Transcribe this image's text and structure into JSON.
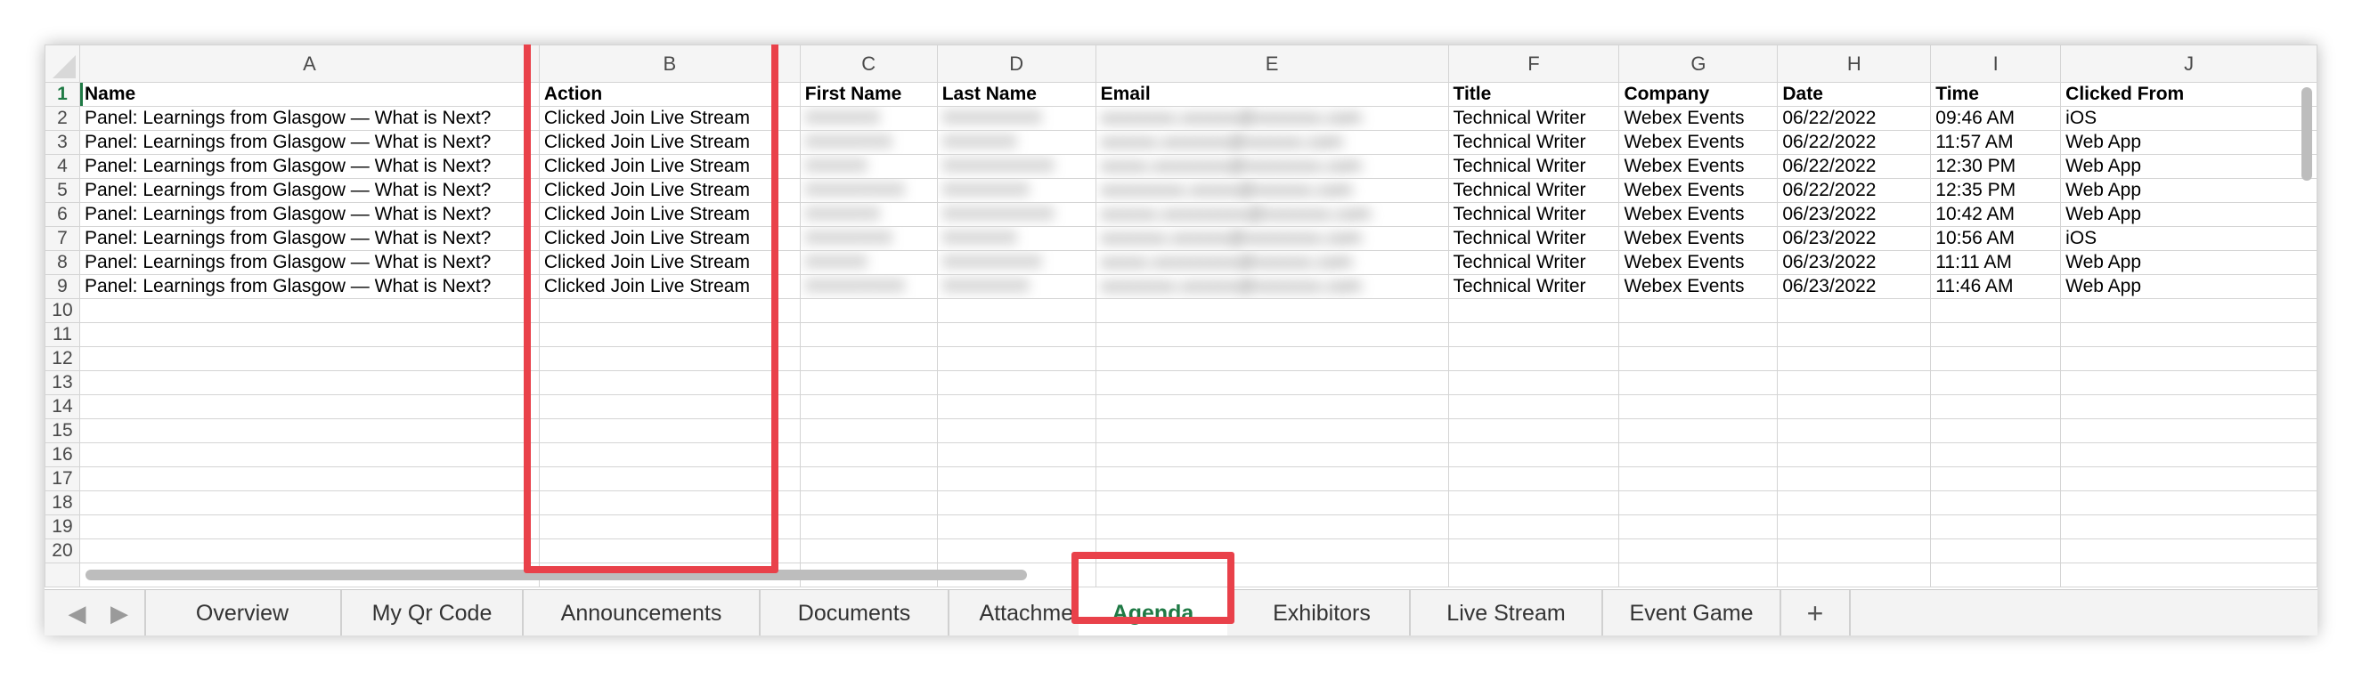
{
  "columns": [
    "A",
    "B",
    "C",
    "D",
    "E",
    "F",
    "G",
    "H",
    "I",
    "J"
  ],
  "header_row": [
    "Name",
    "Action",
    "First Name",
    "Last Name",
    "Email",
    "Title",
    "Company",
    "Date",
    "Time",
    "Clicked From"
  ],
  "rows": [
    [
      "Panel: Learnings from Glasgow — What is Next?",
      "Clicked Join Live Stream",
      "XXXXXX",
      "XXXXXXXX",
      "xxxxxxxx.xxxxxx@xxxxxxx.com",
      "Technical Writer",
      "Webex Events",
      "06/22/2022",
      "09:46 AM",
      "iOS"
    ],
    [
      "Panel: Learnings from Glasgow — What is Next?",
      "Clicked Join Live Stream",
      "XXXXXXX",
      "XXXXXX",
      "xxxxxx.xxxxxxx@xxxxxx.com",
      "Technical Writer",
      "Webex Events",
      "06/22/2022",
      "11:57 AM",
      "Web App"
    ],
    [
      "Panel: Learnings from Glasgow — What is Next?",
      "Clicked Join Live Stream",
      "XXXXX",
      "XXXXXXXXX",
      "xxxxx.xxxxxxxx@xxxxxxxx.com",
      "Technical Writer",
      "Webex Events",
      "06/22/2022",
      "12:30 PM",
      "Web App"
    ],
    [
      "Panel: Learnings from Glasgow — What is Next?",
      "Clicked Join Live Stream",
      "XXXXXXXX",
      "XXXXXXX",
      "xxxxxxxxx.xxxxx@xxxxxx.com",
      "Technical Writer",
      "Webex Events",
      "06/22/2022",
      "12:35 PM",
      "Web App"
    ],
    [
      "Panel: Learnings from Glasgow — What is Next?",
      "Clicked Join Live Stream",
      "XXXXXX",
      "XXXXXXXXX",
      "xxxxxx.xxxxxxxxx@xxxxxxx.com",
      "Technical Writer",
      "Webex Events",
      "06/23/2022",
      "10:42 AM",
      "Web App"
    ],
    [
      "Panel: Learnings from Glasgow — What is Next?",
      "Clicked Join Live Stream",
      "XXXXXXX",
      "XXXXXX",
      "xxxxxxx.xxxxxx@xxxxxxxx.com",
      "Technical Writer",
      "Webex Events",
      "06/23/2022",
      "10:56 AM",
      "iOS"
    ],
    [
      "Panel: Learnings from Glasgow — What is Next?",
      "Clicked Join Live Stream",
      "XXXXX",
      "XXXXXXXX",
      "xxxxx.xxxxxxxxx@xxxxxx.com",
      "Technical Writer",
      "Webex Events",
      "06/23/2022",
      "11:11 AM",
      "Web App"
    ],
    [
      "Panel: Learnings from Glasgow — What is Next?",
      "Clicked Join Live Stream",
      "XXXXXXXX",
      "XXXXXXX",
      "xxxxxxxx.xxxxxx@xxxxxxx.com",
      "Technical Writer",
      "Webex Events",
      "06/23/2022",
      "11:46 AM",
      "Web App"
    ]
  ],
  "row_numbers": [
    "1",
    "2",
    "3",
    "4",
    "5",
    "6",
    "7",
    "8",
    "9",
    "10",
    "11",
    "12",
    "13",
    "14",
    "15",
    "16",
    "17",
    "18",
    "19",
    "20"
  ],
  "tabs": [
    "Overview",
    "My Qr Code",
    "Announcements",
    "Documents",
    "Attachments",
    "Agenda",
    "Exhibitors",
    "Live Stream",
    "Event Game"
  ],
  "active_tab": "Agenda",
  "add_tab_label": "+",
  "nav_prev": "◀",
  "nav_next": "▶",
  "colors": {
    "active": "#1f7a45",
    "highlight": "#e9414a"
  }
}
